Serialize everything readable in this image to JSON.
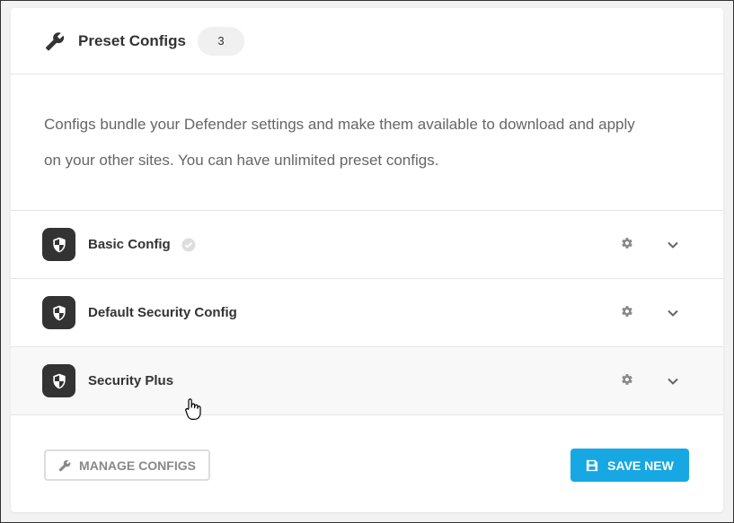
{
  "header": {
    "title": "Preset Configs",
    "count": "3"
  },
  "description": {
    "line1": "Configs bundle your Defender settings and make them available to download and apply",
    "line2": "on your other sites. You can have unlimited preset configs."
  },
  "configs": [
    {
      "label": "Basic Config",
      "default": true
    },
    {
      "label": "Default Security Config",
      "default": false
    },
    {
      "label": "Security Plus",
      "default": false
    }
  ],
  "footer": {
    "manage_label": "MANAGE CONFIGS",
    "save_label": "SAVE NEW"
  },
  "colors": {
    "accent": "#17a8e3",
    "icon_bg": "#333333"
  }
}
